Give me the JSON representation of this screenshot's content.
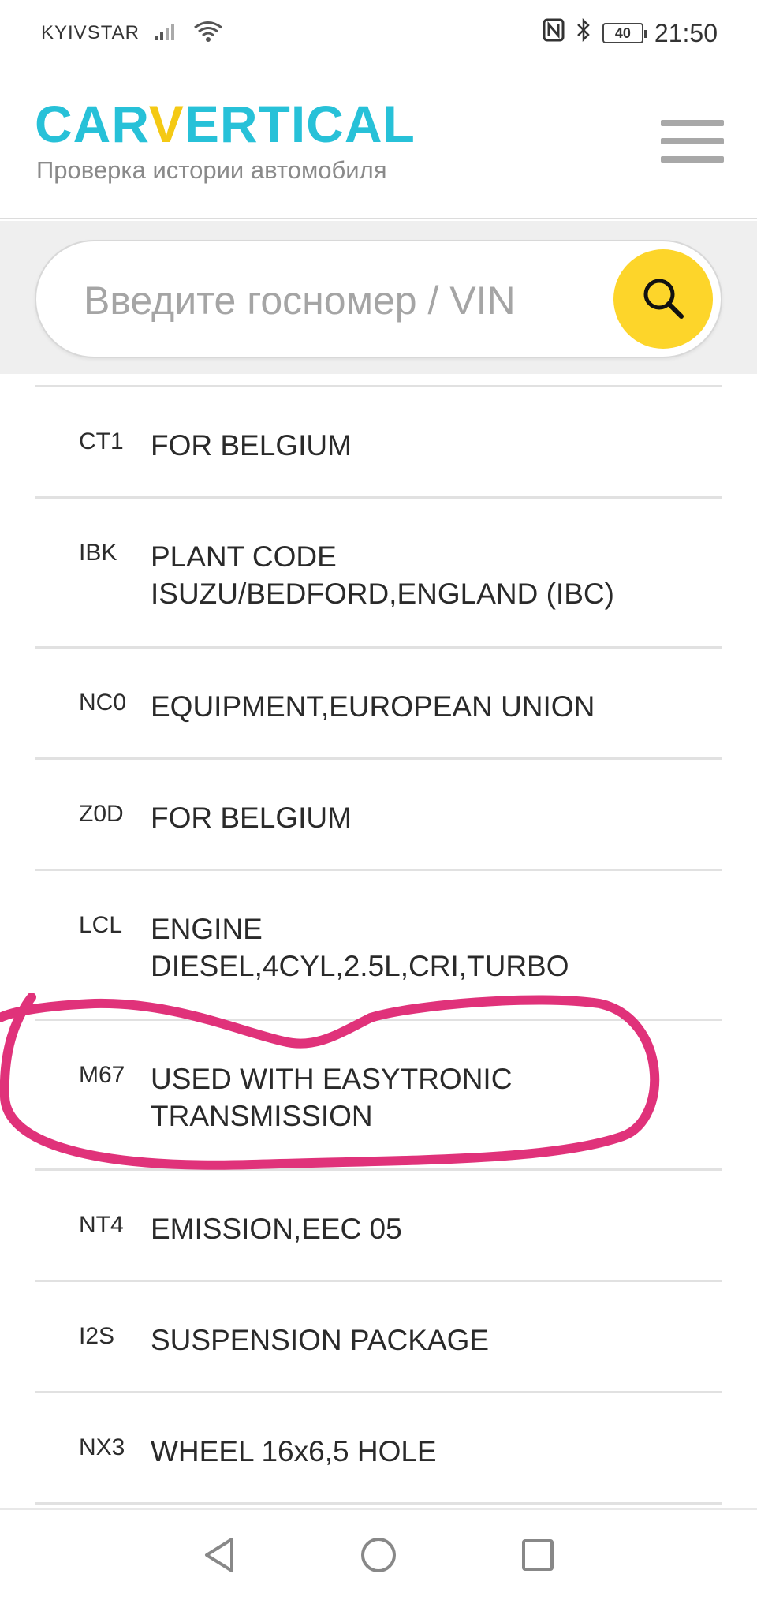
{
  "status_bar": {
    "carrier": "KYIVSTAR",
    "time": "21:50",
    "battery": "40"
  },
  "header": {
    "logo_part1": "CAR",
    "logo_v": "V",
    "logo_part2": "ERTICAL",
    "tagline": "Проверка истории автомобиля"
  },
  "search": {
    "placeholder": "Введите госномер / VIN",
    "value": ""
  },
  "options": [
    {
      "code": "CT1",
      "description": "FOR BELGIUM"
    },
    {
      "code": "IBK",
      "description": "PLANT CODE ISUZU/BEDFORD,ENGLAND (IBC)"
    },
    {
      "code": "NC0",
      "description": "EQUIPMENT,EUROPEAN UNION"
    },
    {
      "code": "Z0D",
      "description": "FOR BELGIUM"
    },
    {
      "code": "LCL",
      "description": "ENGINE DIESEL,4CYL,2.5L,CRI,TURBO"
    },
    {
      "code": "M67",
      "description": "USED WITH EASYTRONIC TRANSMISSION"
    },
    {
      "code": "NT4",
      "description": "EMISSION,EEC 05"
    },
    {
      "code": "I2S",
      "description": "SUSPENSION PACKAGE"
    },
    {
      "code": "NX3",
      "description": "WHEEL 16x6,5 HOLE"
    }
  ],
  "colors": {
    "logo_primary": "#27c1d8",
    "logo_accent": "#f4c914",
    "search_button": "#fdd52a",
    "annotation": "#e0327a"
  },
  "icons": {
    "signal": "signal-icon",
    "wifi": "wifi-icon",
    "nfc": "nfc-icon",
    "bluetooth": "bluetooth-icon",
    "search": "search-icon",
    "menu": "hamburger-menu-icon",
    "back": "back-icon",
    "home": "home-icon",
    "recents": "recents-icon"
  }
}
